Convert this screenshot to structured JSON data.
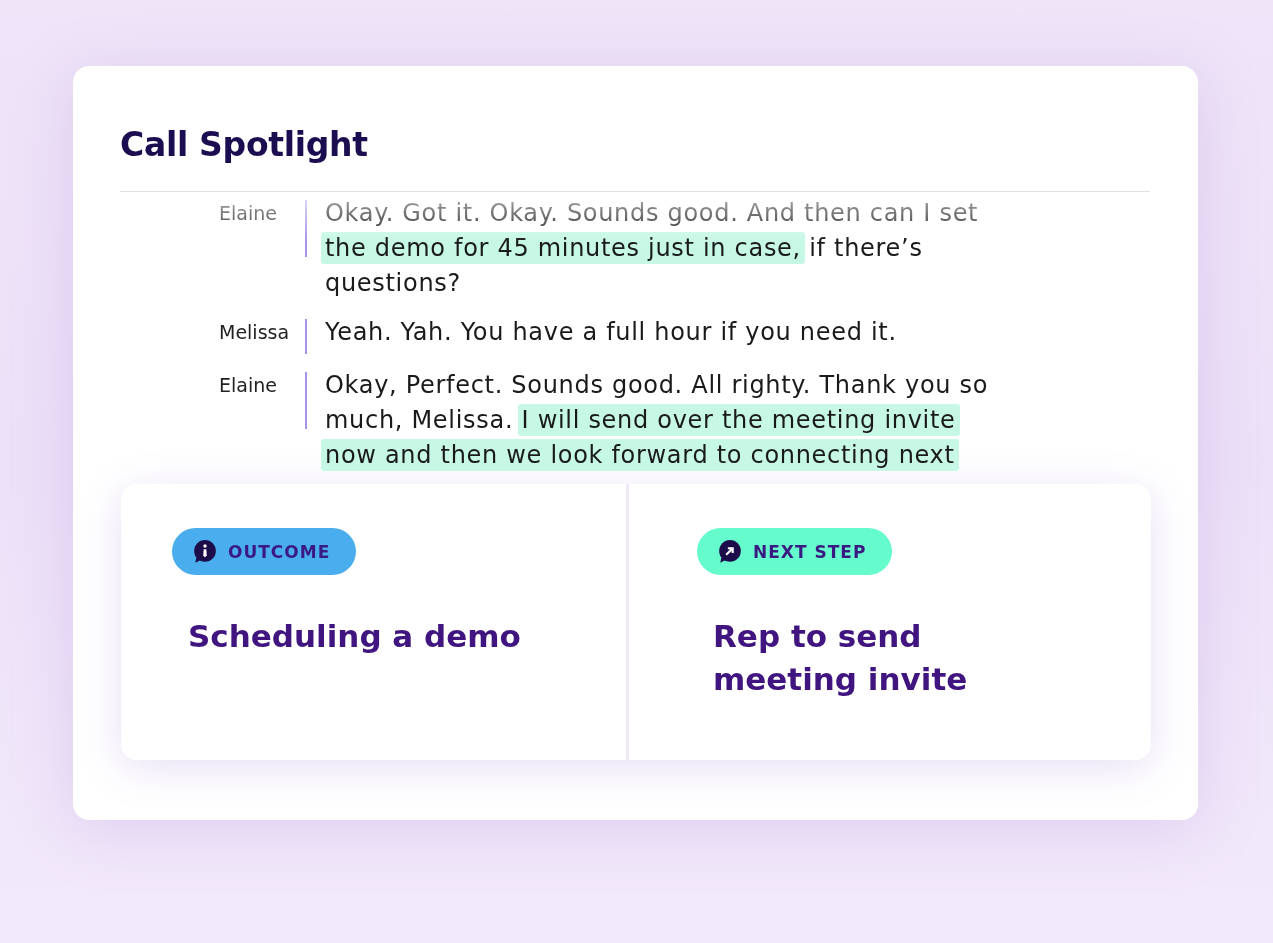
{
  "title": "Call Spotlight",
  "transcript": [
    {
      "speaker": "Elaine",
      "segments": [
        {
          "text": "Okay. Got it. Okay. Sounds good. And then can I set ",
          "highlighted": false
        },
        {
          "text": "the demo for 45 minutes just in case,",
          "highlighted": true
        },
        {
          "text": " if there’s questions?",
          "highlighted": false
        }
      ]
    },
    {
      "speaker": "Melissa",
      "segments": [
        {
          "text": "Yeah. Yah. You have a full hour if you need it.",
          "highlighted": false
        }
      ]
    },
    {
      "speaker": "Elaine",
      "segments": [
        {
          "text": "Okay, Perfect. Sounds good. All righty. Thank you so much, Melissa. ",
          "highlighted": false
        },
        {
          "text": "I will send over the meeting invite now and then we look forward to connecting next",
          "highlighted": true
        }
      ]
    }
  ],
  "insights": [
    {
      "kind": "outcome",
      "label": "OUTCOME",
      "text": "Scheduling a demo"
    },
    {
      "kind": "next_step",
      "label": "NEXT STEP",
      "text": "Rep to send meeting invite"
    }
  ]
}
